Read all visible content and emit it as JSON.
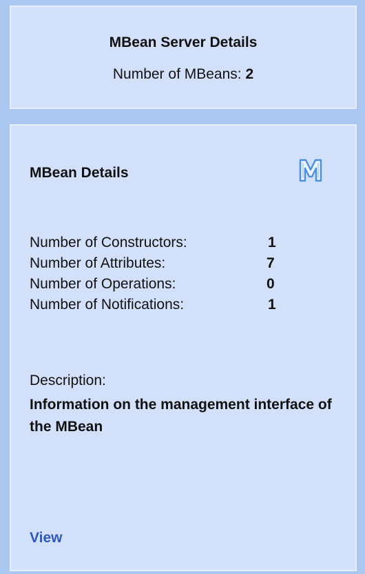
{
  "server": {
    "title": "MBean Server Details",
    "count_label": "Number of MBeans:",
    "count_value": "2"
  },
  "details": {
    "title": "MBean Details",
    "icon": "mbean-m-icon",
    "rows": [
      {
        "label": "Number of Constructors:",
        "value": "1"
      },
      {
        "label": "Number of Attributes:",
        "value": "7"
      },
      {
        "label": "Number of Operations:",
        "value": "0"
      },
      {
        "label": "Number of Notifications:",
        "value": "1"
      }
    ],
    "description_label": "Description:",
    "description": "Information on the management interface of the MBean",
    "view_link": "View"
  },
  "colors": {
    "background": "#aac8ef",
    "panel": "#d2e0fa",
    "link": "#2f58b8",
    "icon": "#4a8fe0"
  }
}
